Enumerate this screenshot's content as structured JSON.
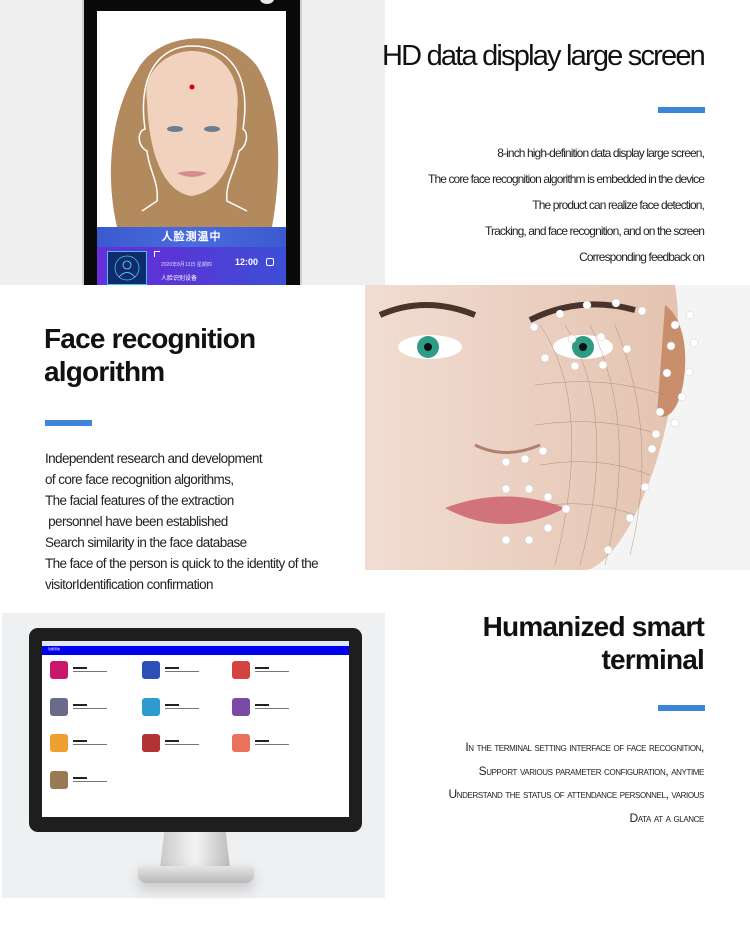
{
  "sections": {
    "hd_display": {
      "title": "HD data display large screen",
      "description": [
        "8-inch high-definition data display large screen,",
        "The core face recognition algorithm is embedded in the device",
        "The product can realize face detection,",
        "Tracking, and face recognition, and on the screen",
        "Corresponding feedback on"
      ],
      "device_screen": {
        "banner": "人脸测温中",
        "date": "2020年8月13日  星期四",
        "time": "12:00",
        "device_name": "人脸识别设备"
      }
    },
    "face_recognition": {
      "title_lines": [
        "Face recognition",
        "algorithm"
      ],
      "description": [
        "Independent research and development",
        "of core face recognition algorithms,",
        "The facial features of the extraction",
        " personnel have been established",
        "Search similarity in the face database",
        "The face of the person is quick to the identity of the",
        "visitorIdentification confirmation"
      ]
    },
    "smart_terminal": {
      "title_lines": [
        "Humanized smart",
        "terminal"
      ],
      "description": [
        "In the terminal setting interface of face recognition,",
        "Support various parameter configuration, anytime",
        "Understand the status of attendance personnel, various",
        "Data at a glance"
      ],
      "monitor_menu_label": "功能导航"
    }
  },
  "colors": {
    "accent": "#3b86d6",
    "screen_banner": "#4a6bde",
    "screen_info": "#5a35d5",
    "monitor_menu_bar": "#0000ee"
  },
  "icons": {
    "monitor_tiles": [
      {
        "name": "gear-settings-icon",
        "color": "#c8176a"
      },
      {
        "name": "contacts-book-icon",
        "color": "#2c4fb8"
      },
      {
        "name": "monitor-settings-icon",
        "color": "#d2443f"
      },
      {
        "name": "record-search-icon",
        "color": "#6a6a8a"
      },
      {
        "name": "surveillance-camera-icon",
        "color": "#2e9ad0"
      },
      {
        "name": "door-settings-icon",
        "color": "#7b4aa6"
      },
      {
        "name": "attendance-icon",
        "color": "#f0a030"
      },
      {
        "name": "footprint-icon",
        "color": "#b23333"
      },
      {
        "name": "worker-helmet-icon",
        "color": "#e8735a"
      },
      {
        "name": "finance-book-icon",
        "color": "#9a7a55"
      }
    ]
  }
}
